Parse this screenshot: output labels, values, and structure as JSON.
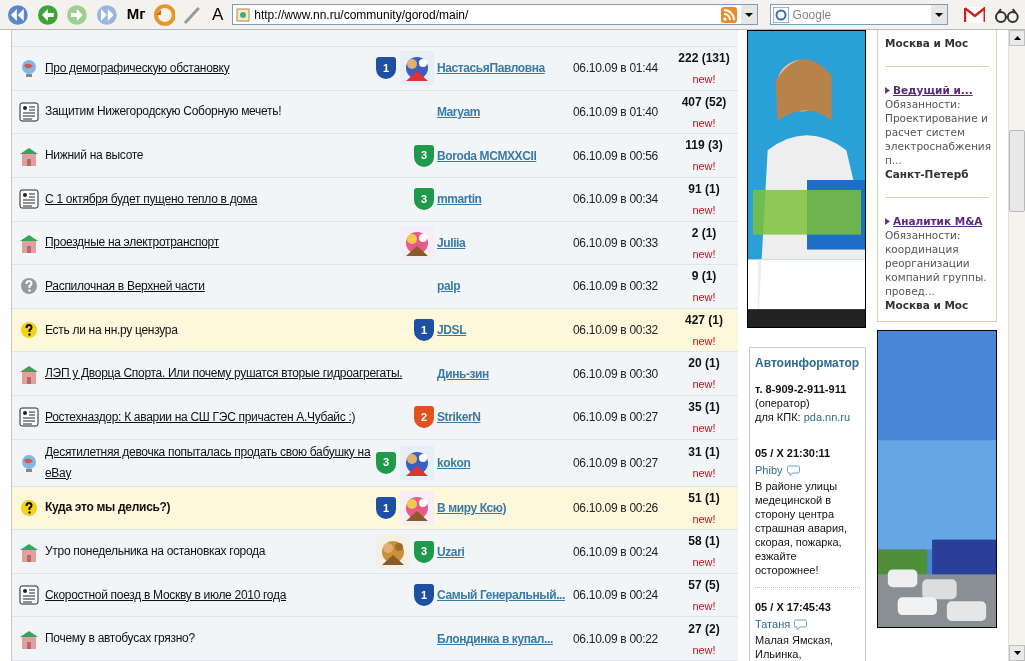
{
  "toolbar": {
    "logo": "Mг",
    "text_size": "A",
    "address": "http://www.nn.ru/community/gorod/main/",
    "search": {
      "placeholder": "Google"
    }
  },
  "topics": [
    {
      "kind": "globe",
      "title": "Про демографическую обстановку",
      "underlined": true,
      "bold": false,
      "highlighted": false,
      "rank": {
        "label": "1",
        "color": "#1f4fa0"
      },
      "author": "НастасьяПавловна",
      "date": "06.10.09 в 01:44",
      "count": "222 (131)",
      "new": "new!"
    },
    {
      "kind": "doc",
      "title": "Защитим Нижегородскую Соборную мечеть!",
      "underlined": false,
      "bold": false,
      "highlighted": false,
      "author": "Maryam",
      "date": "06.10.09 в 01:40",
      "count": "407 (52)",
      "new": "new!"
    },
    {
      "kind": "house",
      "title": "Нижний на высоте",
      "underlined": false,
      "bold": false,
      "highlighted": false,
      "rank": {
        "label": "3",
        "color": "#1f9a4a"
      },
      "author": "Boroda MCMXXCII",
      "date": "06.10.09 в 00:56",
      "count": "119 (3)",
      "new": "new!"
    },
    {
      "kind": "doc",
      "title": "С 1 октября будет пущено тепло в дома",
      "underlined": true,
      "bold": false,
      "highlighted": false,
      "rank": {
        "label": "3",
        "color": "#1f9a4a"
      },
      "author": "mmartin",
      "date": "06.10.09 в 00:34",
      "count": "91 (1)",
      "new": "new!"
    },
    {
      "kind": "house",
      "title": "Проездные на электротранспорт",
      "underlined": true,
      "bold": false,
      "highlighted": false,
      "author": "Juliia",
      "date": "06.10.09 в 00:33",
      "count": "2 (1)",
      "new": "new!"
    },
    {
      "kind": "question",
      "title": "Распилочная в Верхней части",
      "underlined": true,
      "bold": false,
      "highlighted": false,
      "author": "palp",
      "date": "06.10.09 в 00:32",
      "count": "9 (1)",
      "new": "new!"
    },
    {
      "kind": "question_marked",
      "title": "Есть ли на нн.ру цензура",
      "underlined": false,
      "bold": false,
      "highlighted": true,
      "rank": {
        "label": "1",
        "color": "#1f4fa0"
      },
      "author": "JDSL",
      "date": "06.10.09 в 00:32",
      "count": "427 (1)",
      "new": "new!"
    },
    {
      "kind": "house",
      "title": "ЛЭП у Дворца Спорта. Или почему рушатся вторые гидроагрегаты.",
      "underlined": true,
      "bold": false,
      "highlighted": false,
      "author": "Динь-зин",
      "date": "06.10.09 в 00:30",
      "count": "20 (1)",
      "new": "new!"
    },
    {
      "kind": "doc",
      "title": "Ростехназдор: К аварии на СШ ГЭС причастен А.Чубайс :)",
      "underlined": true,
      "bold": false,
      "highlighted": false,
      "rank": {
        "label": "2",
        "color": "#e0521f"
      },
      "author": "StrikerN",
      "date": "06.10.09 в 00:27",
      "count": "35 (1)",
      "new": "new!"
    },
    {
      "kind": "globe",
      "title": "Десятилетняя девочка попыталась продать свою бабушку на eBay",
      "underlined": true,
      "bold": false,
      "highlighted": false,
      "rank": {
        "label": "3",
        "color": "#1f9a4a"
      },
      "author": "kokon",
      "date": "06.10.09 в 00:27",
      "count": "31 (1)",
      "new": "new!"
    },
    {
      "kind": "question_marked",
      "title": "Куда это мы делись?)",
      "underlined": false,
      "bold": true,
      "highlighted": true,
      "rank": {
        "label": "1",
        "color": "#1f4fa0"
      },
      "author": "В миру Ксю)",
      "date": "06.10.09 в 00:26",
      "count": "51 (1)",
      "new": "new!"
    },
    {
      "kind": "house",
      "title": "Утро понедельника на остановках города",
      "underlined": false,
      "bold": false,
      "highlighted": false,
      "rank": {
        "label": "3",
        "color": "#1f9a4a"
      },
      "author": "Uzari",
      "date": "06.10.09 в 00:24",
      "count": "58 (1)",
      "new": "new!"
    },
    {
      "kind": "doc",
      "title": "Скоростной поезд в Москву в июле 2010 года",
      "underlined": true,
      "bold": false,
      "highlighted": false,
      "rank": {
        "label": "1",
        "color": "#1f4fa0"
      },
      "author": "Самый Генеральный...",
      "date": "06.10.09 в 00:24",
      "count": "57 (5)",
      "new": "new!"
    },
    {
      "kind": "house",
      "title": "Почему в автобусах грязно?",
      "underlined": false,
      "bold": false,
      "highlighted": false,
      "author": "Блондинка в купал...",
      "date": "06.10.09 в 00:22",
      "count": "27 (2)",
      "new": "new!"
    }
  ],
  "jobs": [
    {
      "city": "Москва и Мос"
    },
    {
      "title": "Ведущий и...",
      "description": "Обязанности: Проектирование и расчет систем электроснабжения п...",
      "city": "Санкт-Петерб"
    },
    {
      "title": "Аналитик M&A",
      "description": "Обязанности: координация реорганизации компаний группы. провед...",
      "city": "Москва и Мос"
    }
  ],
  "autoinformer": {
    "title": "Автоинформатор",
    "phone": "т. 8-909-2-911-911",
    "operator": "(оператор)",
    "pda_label": "для КПК:",
    "pda_link": "pda.nn.ru",
    "messages": [
      {
        "time": "05 / X 21:30:11",
        "author": "Phiby",
        "text": "В районе улицы медецинской в сторону центра страшная авария, скорая, пожарка, езжайте осторожнее!"
      },
      {
        "time": "05 / X 17:45:43",
        "author": "Татаня",
        "text": "Малая Ямская, Ильинка,"
      }
    ]
  }
}
